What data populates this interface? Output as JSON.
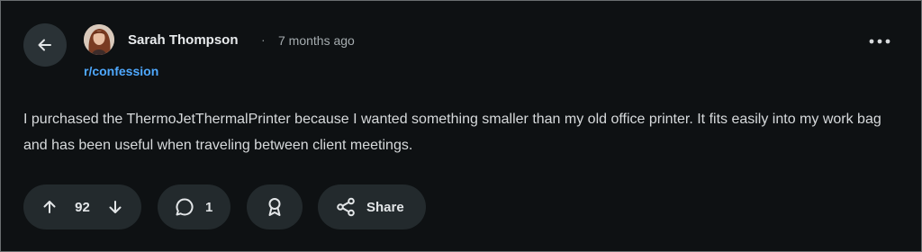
{
  "post": {
    "author": "Sarah Thompson",
    "separator": "·",
    "timestamp": "7 months ago",
    "community": "r/confession",
    "body": "I purchased the ThermoJetThermalPrinter because I wanted something smaller than my old office printer. It fits easily into my work bag and has been useful when traveling between client meetings."
  },
  "actions": {
    "vote_count": "92",
    "comment_count": "1",
    "share_label": "Share"
  },
  "icons": {
    "back": "arrow-left-icon",
    "more": "more-horizontal-icon",
    "upvote": "arrow-up-icon",
    "downvote": "arrow-down-icon",
    "comment": "comment-bubble-icon",
    "award": "award-icon",
    "share": "share-icon"
  },
  "colors": {
    "background": "#0e1113",
    "pill": "#232a2d",
    "community_link": "#4fa9ff"
  }
}
